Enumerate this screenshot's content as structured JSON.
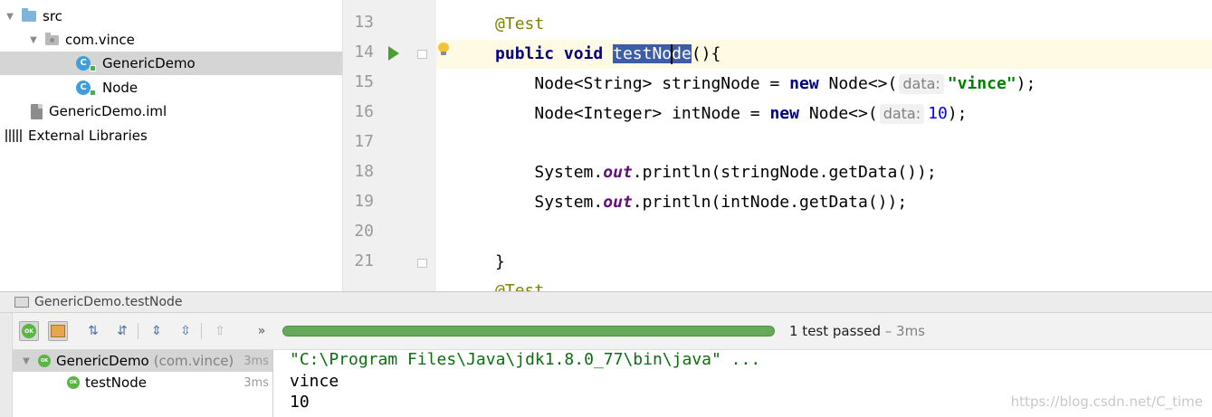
{
  "project_tree": {
    "items": [
      {
        "label": "src",
        "icon": "blue-folder-icon"
      },
      {
        "label": "com.vince",
        "icon": "package-folder-icon"
      },
      {
        "label": "GenericDemo",
        "icon": "java-class-icon",
        "icon_letter": "C"
      },
      {
        "label": "Node",
        "icon": "java-class-icon",
        "icon_letter": "C"
      },
      {
        "label": "GenericDemo.iml",
        "icon": "module-file-icon"
      },
      {
        "label": "External Libraries",
        "icon": "libraries-icon"
      }
    ]
  },
  "editor": {
    "line_numbers": [
      "13",
      "14",
      "15",
      "16",
      "17",
      "18",
      "19",
      "20",
      "21"
    ],
    "line_13": {
      "annotation": "@Test"
    },
    "line_14": {
      "kw_public": "public",
      "kw_void": "void",
      "method_selected": "testNo",
      "method_rest": "de",
      "tail": "(){"
    },
    "line_15": {
      "type_decl": "Node<String> stringNode = ",
      "kw_new": "new",
      "ctor": " Node<>(",
      "param_hint": "data:",
      "string_arg": "\"vince\"",
      "tail": ");"
    },
    "line_16": {
      "type_decl": "Node<Integer> intNode = ",
      "kw_new": "new",
      "ctor": " Node<>(",
      "param_hint": "data:",
      "number_arg": "10",
      "tail": ");"
    },
    "line_18": {
      "prefix": "System.",
      "field": "out",
      "suffix": ".println(stringNode.getData());"
    },
    "line_19": {
      "prefix": "System.",
      "field": "out",
      "suffix": ".println(intNode.getData());"
    },
    "line_21": {
      "text": "}"
    },
    "line_22_partial": {
      "text": "@Test"
    }
  },
  "run_panel": {
    "title": "GenericDemo.testNode",
    "toolbar": {
      "ok_badge": "OK",
      "progress_fraction": 1.0,
      "progress_color": "#67a95b",
      "status_text": "1 test passed",
      "status_duration": " – 3ms",
      "more_glyph": "»"
    },
    "tests": {
      "suite": {
        "name": "GenericDemo",
        "package": "(com.vince)",
        "time": "3ms",
        "badge": "OK"
      },
      "cases": [
        {
          "name": "testNode",
          "time": "3ms",
          "badge": "OK"
        }
      ]
    },
    "console": {
      "lines": [
        "\"C:\\Program Files\\Java\\jdk1.8.0_77\\bin\\java\" ...",
        "vince",
        "10"
      ]
    }
  },
  "watermark": "https://blog.csdn.net/C_time"
}
